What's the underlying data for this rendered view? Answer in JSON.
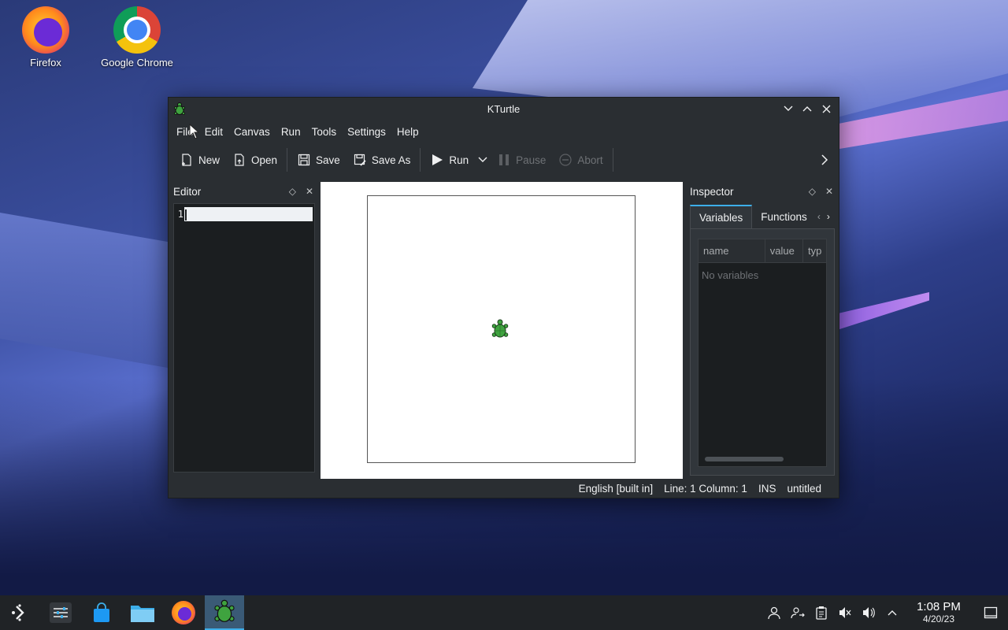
{
  "desktop": {
    "icons": [
      {
        "label": "Firefox"
      },
      {
        "label": "Google Chrome"
      }
    ]
  },
  "window": {
    "title": "KTurtle",
    "menu": [
      "File",
      "Edit",
      "Canvas",
      "Run",
      "Tools",
      "Settings",
      "Help"
    ],
    "toolbar": {
      "new": "New",
      "open": "Open",
      "save": "Save",
      "save_as": "Save As",
      "run": "Run",
      "pause": "Pause",
      "abort": "Abort"
    },
    "editor": {
      "title": "Editor",
      "line_number": "1"
    },
    "inspector": {
      "title": "Inspector",
      "tabs": [
        "Variables",
        "Functions"
      ],
      "columns": [
        "name",
        "value",
        "typ"
      ],
      "empty_text": "No variables"
    },
    "status": {
      "language": "English [built in]",
      "position": "Line: 1 Column: 1",
      "mode": "INS",
      "file": "untitled"
    }
  },
  "taskbar": {
    "time": "1:08 PM",
    "date": "4/20/23"
  },
  "colors": {
    "accent": "#3daee9",
    "window_bg": "#2a2e32",
    "turtle_green": "#3fa33f"
  }
}
